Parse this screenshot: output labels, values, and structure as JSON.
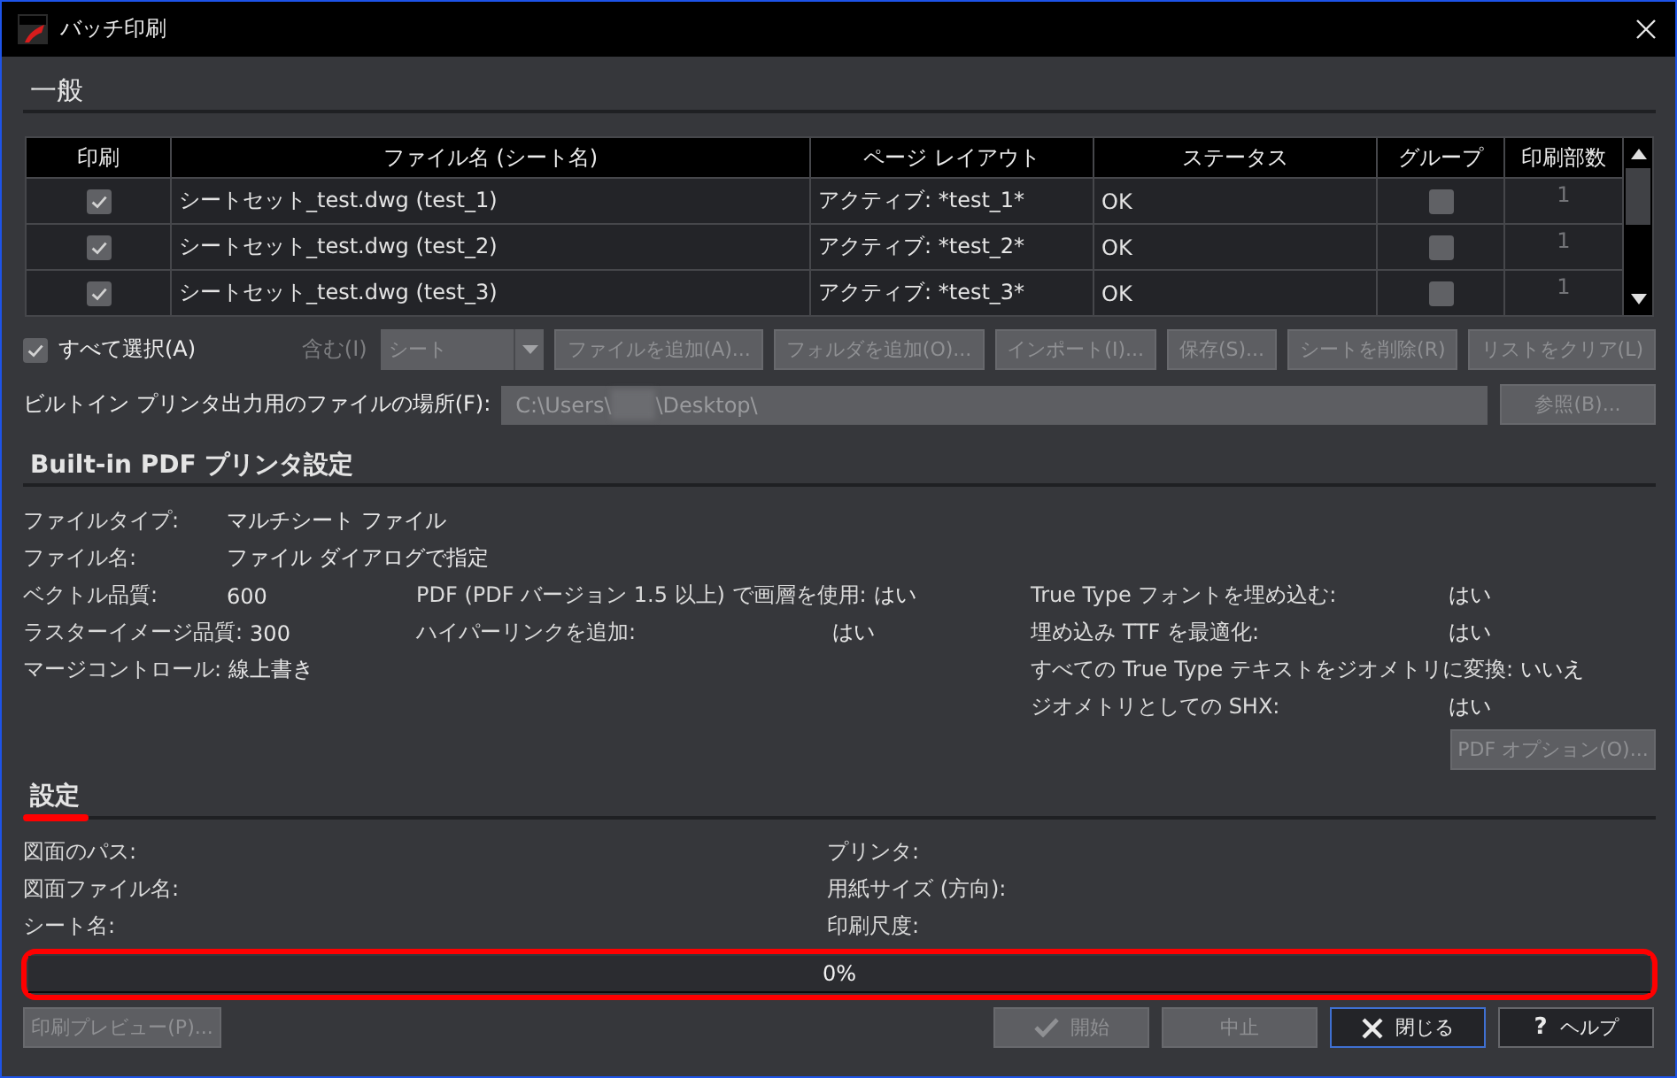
{
  "window": {
    "title": "バッチ印刷"
  },
  "general": {
    "heading": "一般",
    "table": {
      "columns": [
        "印刷",
        "ファイル名 (シート名)",
        "ページ レイアウト",
        "ステータス",
        "グループ",
        "印刷部数"
      ],
      "rows": [
        {
          "print": true,
          "file": "シートセット_test.dwg (test_1)",
          "layout": "アクティブ: *test_1*",
          "status": "OK",
          "group": false,
          "copies": "1"
        },
        {
          "print": true,
          "file": "シートセット_test.dwg (test_2)",
          "layout": "アクティブ: *test_2*",
          "status": "OK",
          "group": false,
          "copies": "1"
        },
        {
          "print": true,
          "file": "シートセット_test.dwg (test_3)",
          "layout": "アクティブ: *test_3*",
          "status": "OK",
          "group": false,
          "copies": "1"
        }
      ]
    },
    "select_all": {
      "label": "すべて選択(A)",
      "checked": true
    },
    "include": {
      "label": "含む(I)",
      "value": "シート",
      "disabled": true
    },
    "buttons": [
      {
        "label": "ファイルを追加(A)...",
        "disabled": true
      },
      {
        "label": "フォルダを追加(O)...",
        "disabled": true
      },
      {
        "label": "インポート(I)...",
        "disabled": true
      },
      {
        "label": "保存(S)...",
        "disabled": true
      },
      {
        "label": "シートを削除(R)",
        "disabled": true
      },
      {
        "label": "リストをクリア(L)",
        "disabled": true
      }
    ],
    "output": {
      "label": "ビルトイン プリンタ出力用のファイルの場所(F):",
      "path_start": "C:\\Users\\",
      "redacted": true,
      "path_end": "\\Desktop\\",
      "disabled": true
    },
    "browse_button": {
      "label": "参照(B)...",
      "disabled": true
    }
  },
  "pdf_printer": {
    "heading": "Built-in PDF プリンタ設定",
    "items": [
      {
        "label": "ファイルタイプ:",
        "value": "マルチシート ファイル"
      },
      {
        "label": "ファイル名:",
        "value": "ファイル ダイアログで指定"
      }
    ],
    "columns": [
      [
        {
          "label": "ベクトル品質:",
          "value": "600"
        },
        {
          "label": "ラスターイメージ品質:",
          "value": "300"
        },
        {
          "label": "マージコントロール:",
          "value": "線上書き"
        }
      ],
      [
        {
          "label": "PDF (PDF バージョン 1.5 以上) で画層を使用:",
          "value": "はい"
        },
        {
          "label": "ハイパーリンクを追加:",
          "value": "はい"
        }
      ],
      [
        {
          "label": "True Type フォントを埋め込む:",
          "value": "はい"
        },
        {
          "label": "埋め込み TTF を最適化:",
          "value": "はい"
        },
        {
          "label": "すべての True Type テキストをジオメトリに変換:",
          "value": "いいえ"
        },
        {
          "label": "ジオメトリとしての SHX:",
          "value": "はい"
        }
      ]
    ],
    "options_button": {
      "label": "PDF オプション(O)...",
      "disabled": true
    }
  },
  "settings": {
    "heading": "設定",
    "highlighted": true,
    "left": [
      "図面のパス:",
      "図面ファイル名:",
      "シート名:"
    ],
    "right": [
      "プリンタ:",
      "用紙サイズ (方向):",
      "印刷尺度:"
    ]
  },
  "progress": {
    "level": 0,
    "reading": "0%",
    "highlighted": true
  },
  "preview_button": {
    "label": "印刷プレビュー(P)...",
    "disabled": true
  },
  "actions": [
    {
      "kind": "start",
      "label": "開始",
      "disabled": true,
      "default": false
    },
    {
      "kind": "stop",
      "label": "中止",
      "disabled": true,
      "default": false
    },
    {
      "kind": "close",
      "label": "閉じる",
      "disabled": false,
      "default": true
    },
    {
      "kind": "help",
      "symbol": "?",
      "label": "ヘルプ",
      "disabled": false,
      "default": false
    }
  ]
}
